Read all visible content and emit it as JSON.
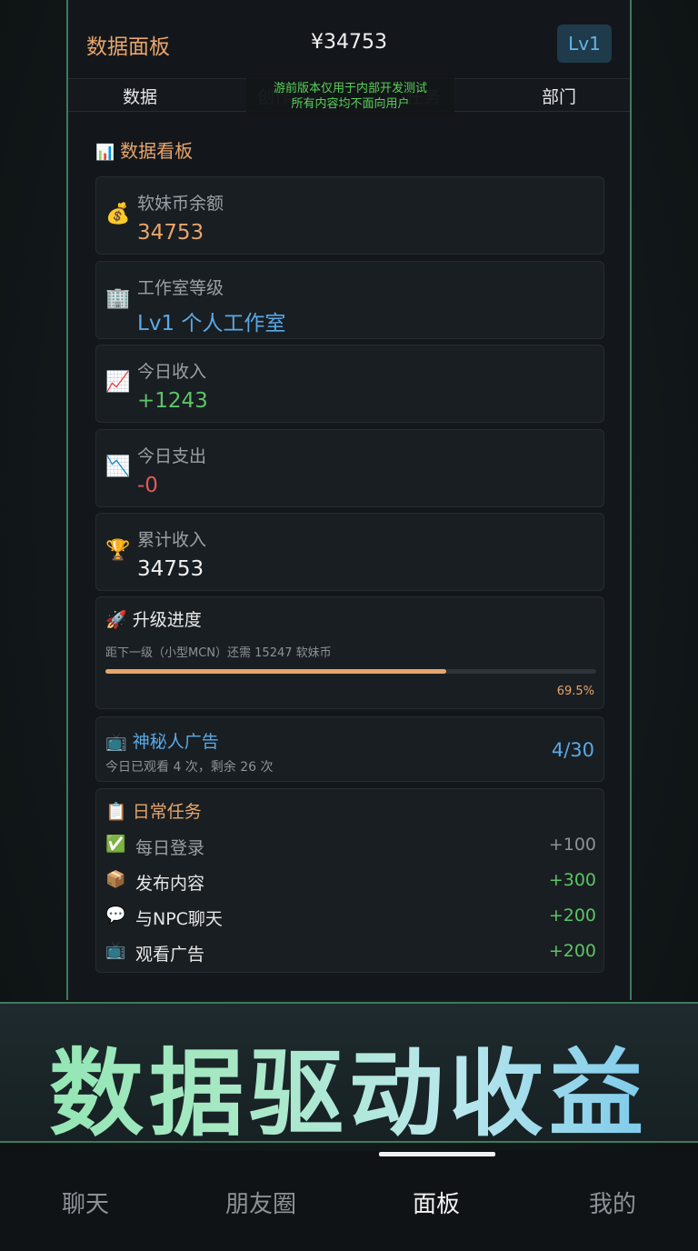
{
  "header": {
    "title": "数据面板",
    "balance": "¥34753",
    "level_badge": "Lv1"
  },
  "tabs": [
    "数据",
    "创作",
    "任务",
    "部门"
  ],
  "notice": {
    "line1": "游前版本仅用于内部开发测试",
    "line2": "所有内容均不面向用户"
  },
  "section": {
    "title": "数据看板",
    "icon": "bar-chart-icon"
  },
  "stats": [
    {
      "icon": "money-bag-icon",
      "glyph": "💰",
      "label": "软妹币余额",
      "value": "34753",
      "color": "#e8a56a"
    },
    {
      "icon": "office-building-icon",
      "glyph": "🏢",
      "label": "工作室等级",
      "value": "Lv1 个人工作室",
      "color": "#5aa9e6"
    },
    {
      "icon": "chart-up-icon",
      "glyph": "📈",
      "label": "今日收入",
      "value": "+1243",
      "color": "#5cc466"
    },
    {
      "icon": "chart-down-icon",
      "glyph": "📉",
      "label": "今日支出",
      "value": "-0",
      "color": "#e05a5a"
    },
    {
      "icon": "trophy-icon",
      "glyph": "🏆",
      "label": "累计收入",
      "value": "34753",
      "color": "#f0f0f0"
    }
  ],
  "upgrade": {
    "icon": "rocket-icon",
    "title": "升级进度",
    "note": "距下一级（小型MCN）还需 15247 软妹币",
    "percent_label": "69.5%",
    "progress": 0.695
  },
  "ad": {
    "icon": "tv-icon",
    "title": "神秘人广告",
    "note": "今日已观看 4 次，剩余 26 次",
    "count": "4/30"
  },
  "tasks": {
    "icon": "clipboard-icon",
    "title": "日常任务",
    "items": [
      {
        "icon": "check-icon",
        "glyph": "✅",
        "label": "每日登录",
        "reward": "+100",
        "reward_color": "#8c9298"
      },
      {
        "icon": "package-icon",
        "glyph": "📦",
        "label": "发布内容",
        "reward": "+300",
        "reward_color": "#5cc466"
      },
      {
        "icon": "speech-bubble-icon",
        "glyph": "💬",
        "label": "与NPC聊天",
        "reward": "+200",
        "reward_color": "#5cc466"
      },
      {
        "icon": "tv-icon",
        "glyph": "📺",
        "label": "观看广告",
        "reward": "+200",
        "reward_color": "#5cc466"
      }
    ]
  },
  "promo": "数据驱动收益",
  "nav": [
    "聊天",
    "朋友圈",
    "面板",
    "我的"
  ],
  "nav_active": 2
}
